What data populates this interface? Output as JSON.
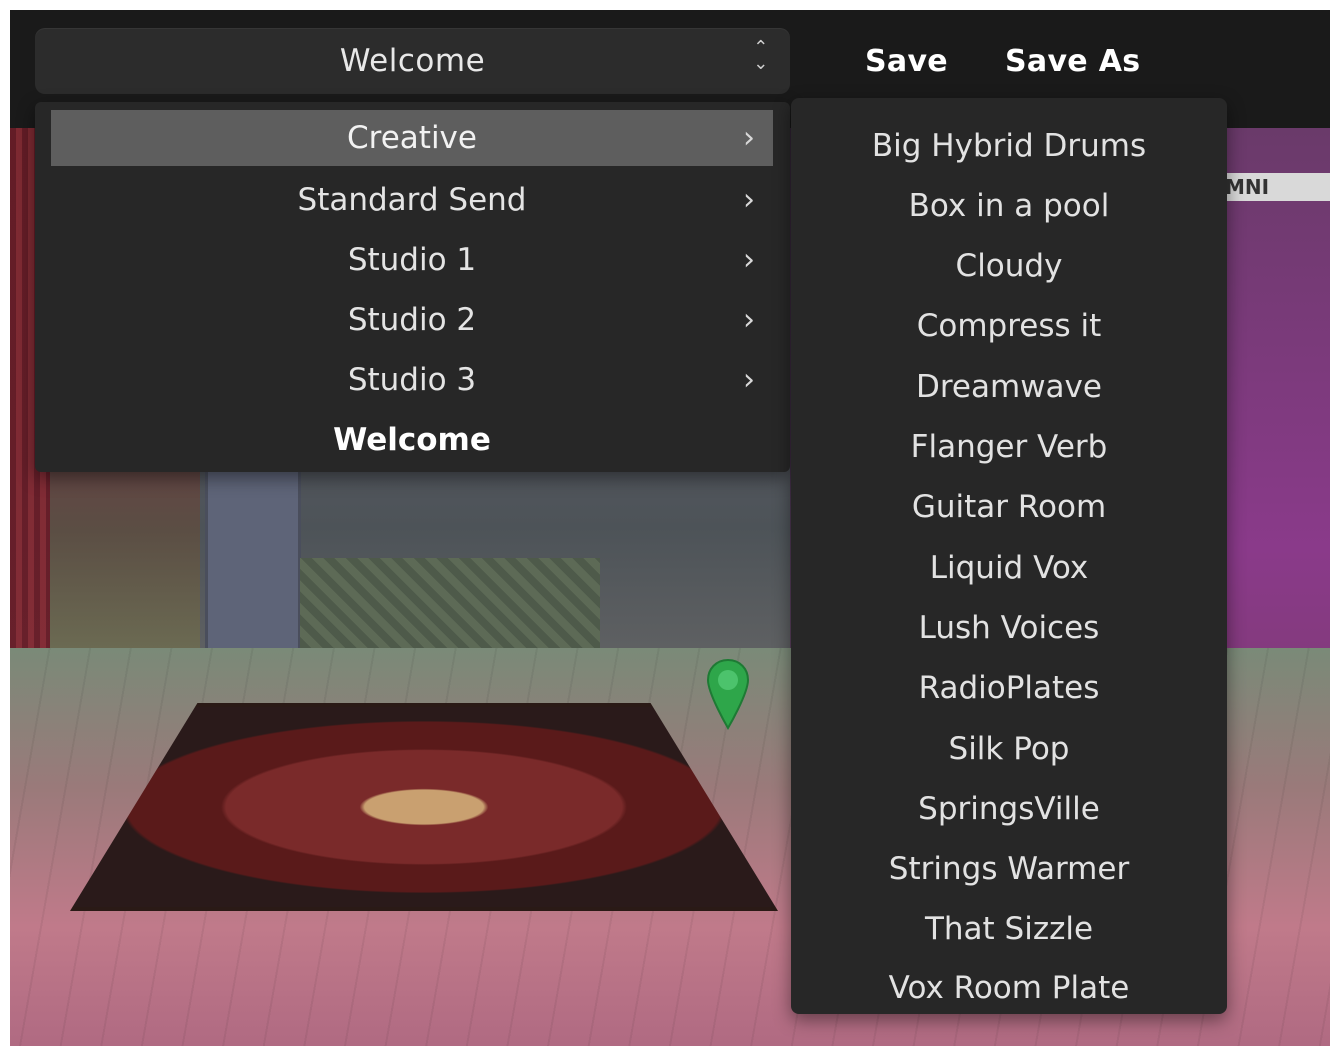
{
  "toolbar": {
    "preset_value": "Welcome",
    "save_label": "Save",
    "save_as_label": "Save As"
  },
  "menu": {
    "categories": [
      {
        "label": "Creative",
        "has_submenu": true,
        "highlighted": true
      },
      {
        "label": "Standard Send",
        "has_submenu": true
      },
      {
        "label": "Studio 1",
        "has_submenu": true
      },
      {
        "label": "Studio 2",
        "has_submenu": true
      },
      {
        "label": "Studio 3",
        "has_submenu": true
      },
      {
        "label": "Welcome",
        "has_submenu": false,
        "selected": true
      }
    ],
    "submenu_items": [
      "Big Hybrid Drums",
      "Box in a pool",
      "Cloudy",
      "Compress it",
      "Dreamwave",
      "Flanger Verb",
      "Guitar Room",
      "Liquid Vox",
      "Lush Voices",
      "RadioPlates",
      "Silk Pop",
      "SpringsVille",
      "Strings Warmer",
      "That Sizzle",
      "Vox Room Plate"
    ]
  },
  "background": {
    "partial_label": "MNI"
  },
  "icons": {
    "updown": "updown-chevron-icon",
    "chevron_right": "chevron-right-icon",
    "marker": "map-pin-icon"
  },
  "colors": {
    "menu_bg": "#272727",
    "highlight_bg": "#5e5e5e",
    "marker": "#2ea64a"
  }
}
